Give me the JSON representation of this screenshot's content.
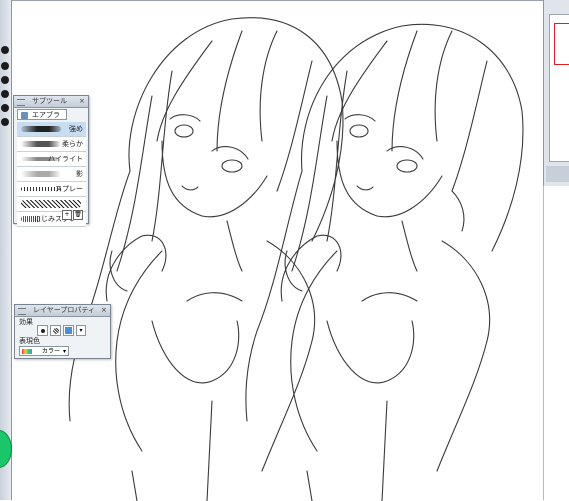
{
  "subtool_panel": {
    "title": "サブツール",
    "close_icon": "close-icon",
    "active_tab": "エアブラシ",
    "brushes": [
      {
        "label": "強め",
        "selected": true
      },
      {
        "label": "柔らか",
        "selected": false
      },
      {
        "label": "ハイライト",
        "selected": false
      },
      {
        "label": "影",
        "selected": false
      },
      {
        "label": "スプレー",
        "selected": false
      },
      {
        "label": "",
        "selected": false
      },
      {
        "label": "にじみスプレー",
        "selected": false
      }
    ],
    "footer_icons": [
      "new-subtool-icon",
      "delete-subtool-icon"
    ]
  },
  "layer_property_panel": {
    "title": "レイヤープロパティ",
    "effect_label": "効果",
    "expression_label": "表現色",
    "expression_value": "カラー"
  },
  "navigator": {
    "frame_color": "#e02020"
  },
  "colors": {
    "accent_green": "#19c66a",
    "selected_row": "#c8dcf2",
    "panel_bg": "#f0f3f6"
  }
}
